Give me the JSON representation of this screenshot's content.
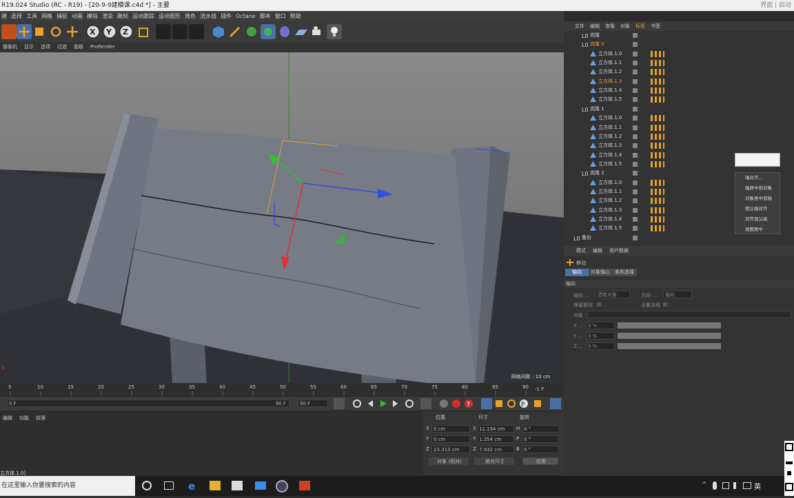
{
  "window": {
    "title": "R19.024 Studio (RC - R19) - [20-9-9建模课.c4d *] - 主要",
    "right_label": "界面 | 启动"
  },
  "menu": [
    "建",
    "选择",
    "工具",
    "网格",
    "捕捉",
    "动画",
    "模拟",
    "渲染",
    "雕刻",
    "运动跟踪",
    "运动图形",
    "角色",
    "流水线",
    "插件",
    "Octane",
    "脚本",
    "窗口",
    "帮助"
  ],
  "viewport_menu": [
    "摄像机",
    "显示",
    "选项",
    "过滤",
    "面板",
    "ProRender"
  ],
  "viewport": {
    "grid_spacing": "网格间距 : 10 cm"
  },
  "ruler_ticks": [
    "5",
    "10",
    "15",
    "20",
    "25",
    "30",
    "35",
    "40",
    "45",
    "50",
    "55",
    "60",
    "65",
    "70",
    "75",
    "80",
    "85",
    "90"
  ],
  "ruler_end": "-1 F",
  "timeline": {
    "start": "0 F",
    "end": "90 F",
    "end_field": "90 F"
  },
  "material_menu": [
    "编辑",
    "功能",
    "纹理"
  ],
  "coords": {
    "headers": [
      "位置",
      "尺寸",
      "旋转"
    ],
    "rows": [
      {
        "axis": "X",
        "pos": "0 cm",
        "size_axis": "X",
        "size": "11.194 cm",
        "rot_axis": "H",
        "rot": "0 °"
      },
      {
        "axis": "Y",
        "pos": "0 cm",
        "size_axis": "Y",
        "size": "1.354 cm",
        "rot_axis": "P",
        "rot": "0 °"
      },
      {
        "axis": "Z",
        "pos": "23.313 cm",
        "size_axis": "Z",
        "size": "7.932 cm",
        "rot_axis": "B",
        "rot": "0 °"
      }
    ],
    "mode": "对象 (相对)",
    "size_mode": "绝对尺寸",
    "apply": "应用"
  },
  "status": "立方体.1.0]",
  "object_manager": {
    "tabs": [
      "文件",
      "编辑",
      "查看",
      "对象",
      "标签",
      "书签"
    ],
    "rows": [
      {
        "label": "克隆",
        "indent": 1,
        "type": "group"
      },
      {
        "label": "克隆 0",
        "indent": 1,
        "type": "group",
        "highlight": true
      },
      {
        "label": "立方体.1.0",
        "indent": 2,
        "type": "cube"
      },
      {
        "label": "立方体.1.1",
        "indent": 2,
        "type": "cube"
      },
      {
        "label": "立方体.1.2",
        "indent": 2,
        "type": "cube"
      },
      {
        "label": "立方体.1.3",
        "indent": 2,
        "type": "cube",
        "highlight": true
      },
      {
        "label": "立方体.1.4",
        "indent": 2,
        "type": "cube"
      },
      {
        "label": "立方体.1.5",
        "indent": 2,
        "type": "cube"
      },
      {
        "label": "克隆 1",
        "indent": 1,
        "type": "group"
      },
      {
        "label": "立方体.1.0",
        "indent": 2,
        "type": "cube"
      },
      {
        "label": "立方体.1.1",
        "indent": 2,
        "type": "cube"
      },
      {
        "label": "立方体.1.2",
        "indent": 2,
        "type": "cube"
      },
      {
        "label": "立方体.1.3",
        "indent": 2,
        "type": "cube"
      },
      {
        "label": "立方体.1.4",
        "indent": 2,
        "type": "cube"
      },
      {
        "label": "立方体.1.5",
        "indent": 2,
        "type": "cube"
      },
      {
        "label": "克隆 2",
        "indent": 1,
        "type": "group"
      },
      {
        "label": "立方体.1.0",
        "indent": 2,
        "type": "cube"
      },
      {
        "label": "立方体.1.1",
        "indent": 2,
        "type": "cube"
      },
      {
        "label": "立方体.1.2",
        "indent": 2,
        "type": "cube"
      },
      {
        "label": "立方体.1.3",
        "indent": 2,
        "type": "cube"
      },
      {
        "label": "立方体.1.4",
        "indent": 2,
        "type": "cube"
      },
      {
        "label": "立方体.1.5",
        "indent": 2,
        "type": "cube"
      },
      {
        "label": "备份",
        "indent": 0,
        "type": "group"
      }
    ]
  },
  "context_menu": [
    "轴对齐...",
    "轴居中到对象",
    "对象居中到轴",
    "使父级对齐",
    "对齐到父级",
    "视图居中"
  ],
  "attributes": {
    "menu": [
      "模式",
      "编辑",
      "用户数据"
    ],
    "tool": "移动",
    "tabs": [
      "轴向",
      "对象轴心",
      "柔和选择"
    ],
    "section": "轴向",
    "axis_label": "轴向 ...",
    "axis_value": "选取对象",
    "dir_label": "方向 ...",
    "dir_value": "轴向",
    "keep_changes": "保留更改",
    "along_normals": "沿着法线",
    "object_label": "对象",
    "xyz": [
      {
        "label": "X ...",
        "value": "0 %"
      },
      {
        "label": "Y ...",
        "value": "0 %"
      },
      {
        "label": "Z ...",
        "value": "0 %"
      }
    ]
  },
  "taskbar": {
    "search": "在这里输入你要搜索的内容",
    "ime": "英",
    "sys_icons": [
      "^",
      "mic",
      "net",
      "vol",
      "kbd"
    ]
  },
  "colors": {
    "accent_orange": "#e8a030",
    "axis_x": "#e03030",
    "axis_y": "#30c030",
    "axis_z": "#3050e0",
    "selected_tab": "#4a6fa5"
  }
}
